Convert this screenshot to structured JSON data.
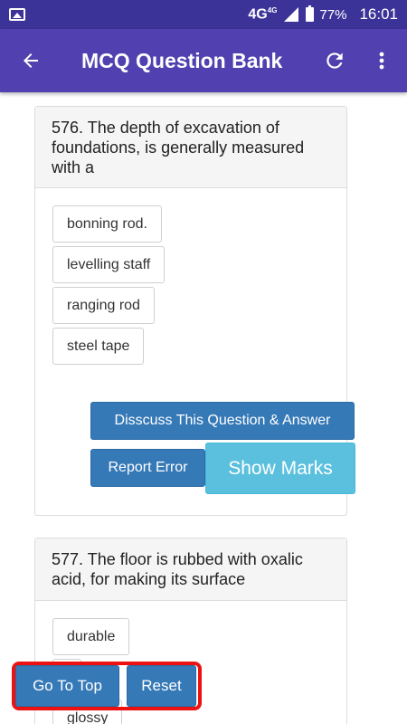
{
  "status_bar": {
    "network": "4G",
    "network_sup": "4G",
    "battery": "77%",
    "time": "16:01"
  },
  "app_bar": {
    "title": "MCQ Question Bank",
    "back_icon": "arrow-left-icon",
    "refresh_icon": "refresh-icon",
    "menu_icon": "more-vert-icon"
  },
  "questions": [
    {
      "text": "576. The depth of excavation of foundations, is generally measured with a",
      "options": [
        "bonning rod.",
        "levelling staff",
        "ranging rod",
        "steel tape"
      ],
      "discuss_label": "Disscuss This Question & Answer",
      "report_label": "Report Error",
      "marks_label": "Show Marks"
    },
    {
      "text": "577. The floor is rubbed with oxalic acid, for making its surface",
      "options": [
        "durable",
        "",
        "glossy"
      ]
    }
  ],
  "floating": {
    "top_label": "Go To Top",
    "reset_label": "Reset"
  },
  "colors": {
    "app_bar": "#5040b0",
    "status_bar": "#3c3398",
    "primary_button": "#3579b7",
    "info_button": "#5bc0de",
    "highlight_border": "#ee1111"
  }
}
